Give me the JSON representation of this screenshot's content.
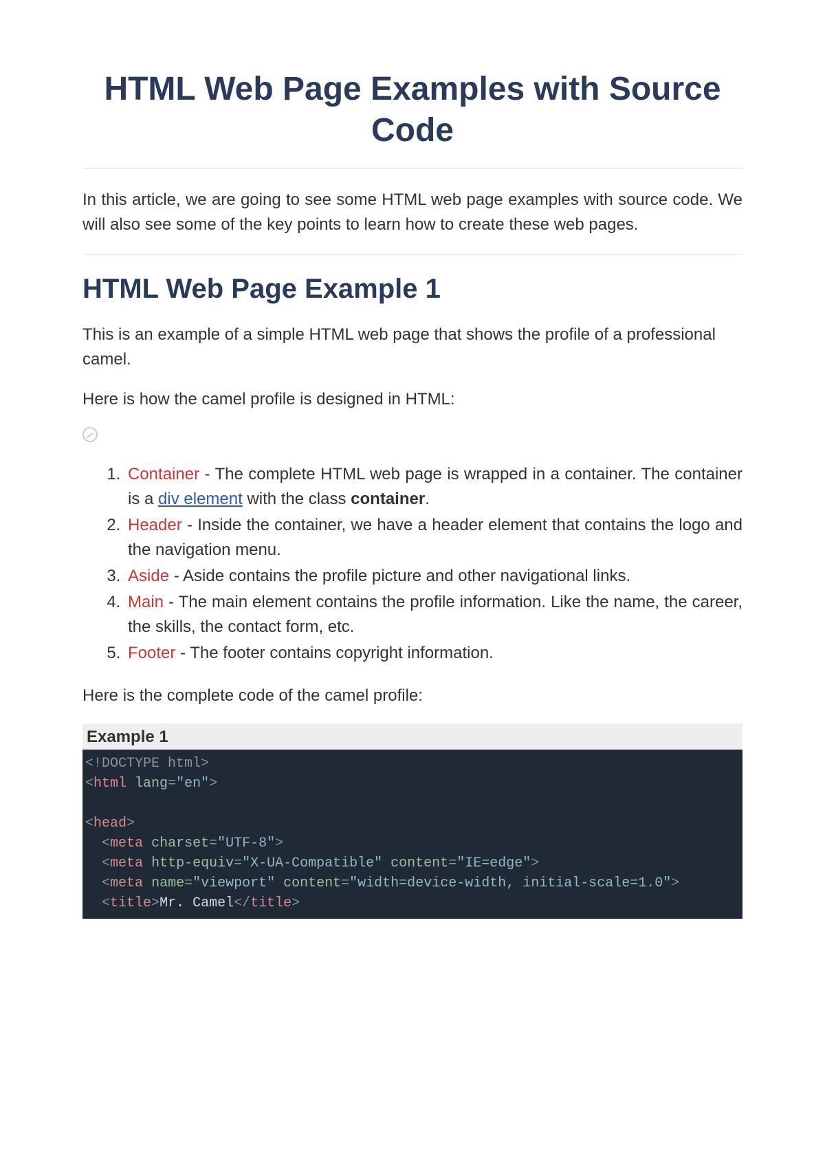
{
  "title": "HTML Web Page Examples with Source Code",
  "intro": "In this article, we are going to see some HTML web page examples with source code. We will also see some of the key points to learn how to create these web pages.",
  "section1": {
    "heading": "HTML Web Page Example 1",
    "p1": "This is an example of a simple HTML web page that shows the profile of a professional camel.",
    "p2": "Here is how the camel profile is designed in HTML:",
    "list": [
      {
        "term": "Container",
        "text_a": " - The complete HTML web page is wrapped in a container. The container is a ",
        "link": "div element",
        "text_b": " with the class ",
        "bold": "container",
        "suffix": "."
      },
      {
        "term": "Header",
        "text": " - Inside the container, we have a header element that contains the logo and the navigation menu."
      },
      {
        "term": "Aside",
        "text": " - Aside contains the profile picture and other navigational links."
      },
      {
        "term": "Main",
        "text": " - The main element contains the profile information. Like the name, the career, the skills, the contact form, etc."
      },
      {
        "term": "Footer",
        "text": " - The footer contains copyright information."
      }
    ],
    "p3": "Here is the complete code of the camel profile:",
    "example_label": "Example 1"
  },
  "code": {
    "doctype_open": "<!",
    "doctype_text": "DOCTYPE html",
    "tag_html": "html",
    "attr_lang": "lang",
    "val_lang": "\"en\"",
    "tag_head": "head",
    "tag_meta": "meta",
    "attr_charset": "charset",
    "val_charset": "\"UTF-8\"",
    "attr_httpequiv": "http-equiv",
    "val_httpequiv": "\"X-UA-Compatible\"",
    "attr_content": "content",
    "val_ieedge": "\"IE=edge\"",
    "attr_name": "name",
    "val_viewport_name": "\"viewport\"",
    "val_viewport_content": "\"width=device-width, initial-scale=1.0\"",
    "tag_title": "title",
    "title_text": "Mr. Camel"
  }
}
